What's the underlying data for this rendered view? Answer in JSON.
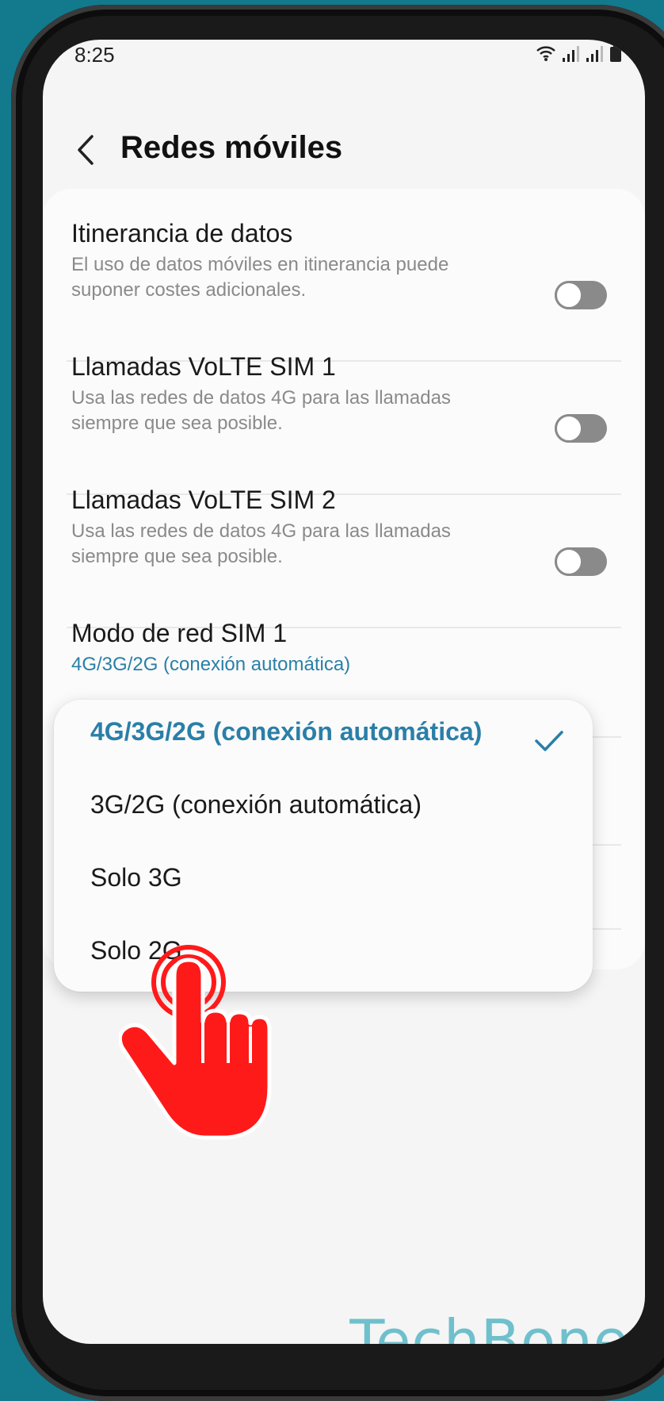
{
  "status_bar": {
    "time": "8:25",
    "icons": [
      "wifi-icon",
      "signal-icon",
      "signal-icon",
      "battery-icon"
    ]
  },
  "header": {
    "back_icon": "chevron-left-icon",
    "title": "Redes móviles"
  },
  "settings": [
    {
      "title": "Itinerancia de datos",
      "subtitle": "El uso de datos móviles en itinerancia puede suponer costes adicionales.",
      "toggle_on": false
    },
    {
      "title": "Llamadas VoLTE SIM 1",
      "subtitle": "Usa las redes de datos 4G para las llamadas siempre que sea posible.",
      "toggle_on": false
    },
    {
      "title": "Llamadas VoLTE SIM 2",
      "subtitle": "Usa las redes de datos 4G para las llamadas siempre que sea posible.",
      "toggle_on": false
    },
    {
      "title": "Modo de red SIM 1",
      "subtitle": "4G/3G/2G (conexión automática)"
    }
  ],
  "dropdown": {
    "options": [
      "4G/3G/2G (conexión automática)",
      "3G/2G (conexión automática)",
      "Solo 3G",
      "Solo 2G"
    ],
    "selected_index": 0,
    "selected_icon": "checkmark-icon"
  },
  "overlay": {
    "icon": "tap-hand-icon"
  },
  "watermark": "TechBone",
  "colors": {
    "accent": "#2a7fa8",
    "background": "#127a8c",
    "hand": "#ff1a1a",
    "watermark": "#6fc0cc"
  }
}
